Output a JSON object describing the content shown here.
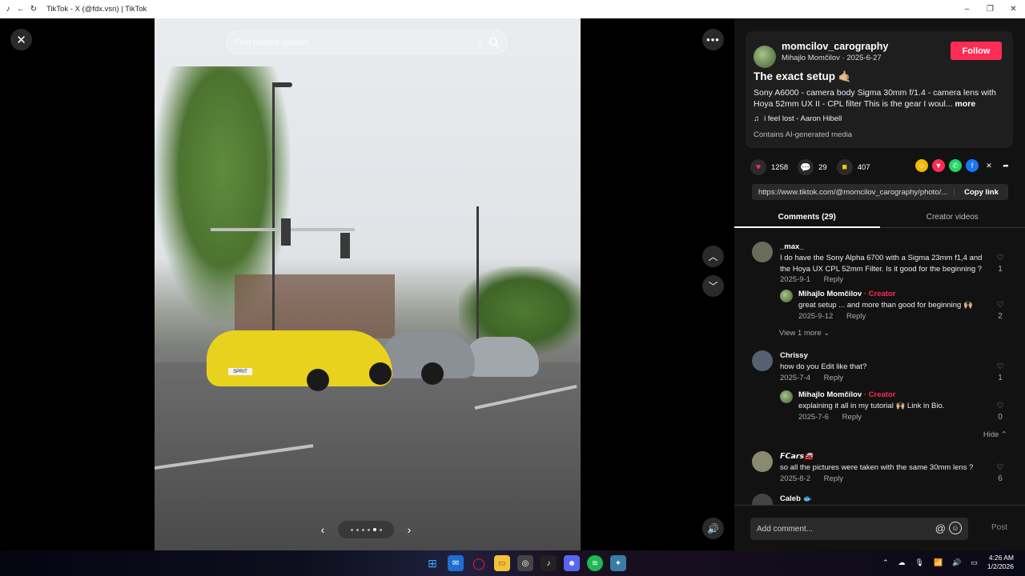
{
  "titlebar": {
    "title": "TikTok - X (@fdx.vsn) | TikTok"
  },
  "viewer": {
    "search_placeholder": "Find related content",
    "car_plate": "SPRIT"
  },
  "post": {
    "username": "momcilov_carography",
    "display_name": "Mihajlo Momčilov",
    "date": "2025-6-27",
    "follow_label": "Follow",
    "title": "The exact setup 🤙🏼",
    "description": "Sony A6000 - camera body Sigma 30mm f/1.4 - camera lens with Hoya 52mm UX II - CPL filter This is the gear I woul...",
    "more_label": "more",
    "music": "i feel lost - Aaron Hibell",
    "ai_label": "Contains AI-generated media"
  },
  "actions": {
    "likes": "1258",
    "comments": "29",
    "saves": "407"
  },
  "link": {
    "url": "https://www.tiktok.com/@momcilov_carography/photo/...",
    "copy_label": "Copy link"
  },
  "tabs": {
    "comments": "Comments (29)",
    "creator_videos": "Creator videos"
  },
  "comments": [
    {
      "name": "_max_",
      "text": "I do have the Sony Alpha 6700 with a Sigma 23mm f1,4 and the Hoya UX CPL 52mm Filter. Is it good for the beginning ?",
      "date": "2025-9-1",
      "likes": "1"
    },
    {
      "name": "Mihajlo Momčilov",
      "creator": "· Creator",
      "text": "great setup ... and more than good for beginning 🙌🏼",
      "date": "2025-9-12",
      "likes": "2"
    },
    {
      "name": "Chrissy",
      "text": "how do you Edit like that?",
      "date": "2025-7-4",
      "likes": "1"
    },
    {
      "name": "Mihajlo Momčilov",
      "creator": "· Creator",
      "text": "explaining it all in my tutorial 🙌🏼 Link in Bio.",
      "date": "2025-7-6",
      "likes": "0"
    },
    {
      "name": "𝙁𝘾𝙖𝙧𝙨🚘",
      "text": "so all the pictures were taken with the same 30mm lens ?",
      "date": "2025-8-2",
      "likes": "6"
    },
    {
      "name": "Caleb 🐟"
    }
  ],
  "reply_label": "Reply",
  "view_more": "View 1 more",
  "hide_label": "Hide",
  "input": {
    "placeholder": "Add comment...",
    "post_label": "Post"
  },
  "clock": {
    "time": "4:26 AM",
    "date": "1/2/2026"
  },
  "colors": {
    "accent": "#fe2c55",
    "panel_bg": "#121212"
  }
}
